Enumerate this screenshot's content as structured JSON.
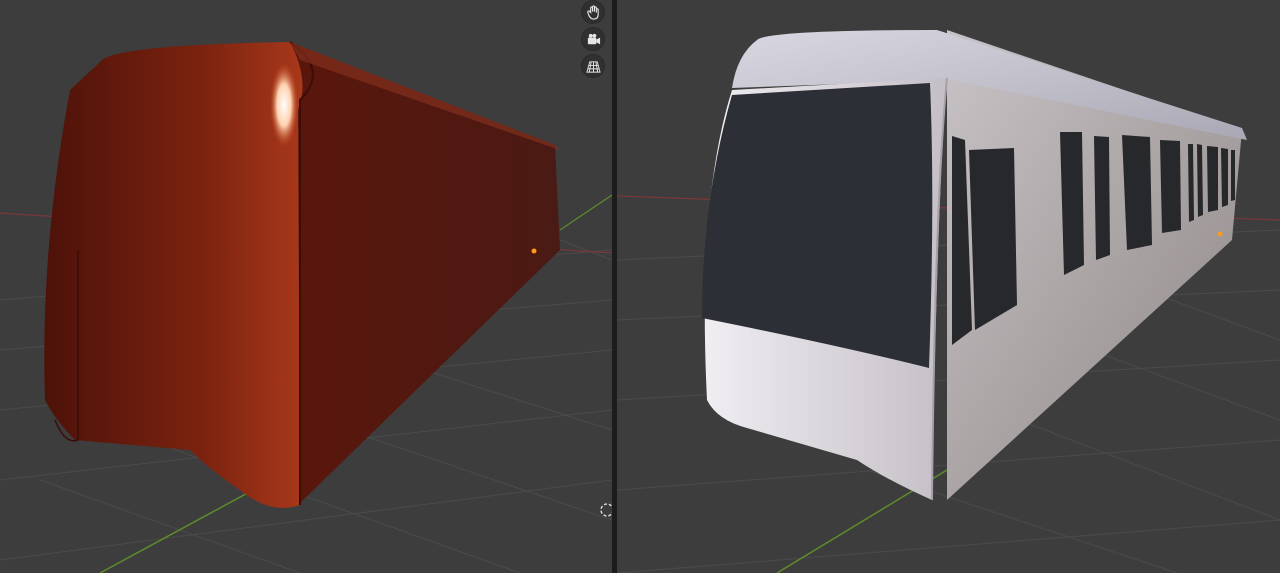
{
  "colors": {
    "grid_background": "#3d3d3d",
    "grid_line": "#4a4a4a",
    "x_axis": "#8a3a3a",
    "y_axis": "#5e8c2a",
    "origin": "#ff9a1f",
    "body_left": "#6e1c0c",
    "body_right": "#c9c3cc",
    "windows": "#2a2c30"
  },
  "left_viewport": {
    "object": "train-body",
    "shading": "material-preview-red",
    "gizmos": [
      "hand-icon",
      "camera-icon",
      "grid-perspective-icon"
    ]
  },
  "right_viewport": {
    "object": "train-body",
    "shading": "solid-white-with-windows"
  }
}
